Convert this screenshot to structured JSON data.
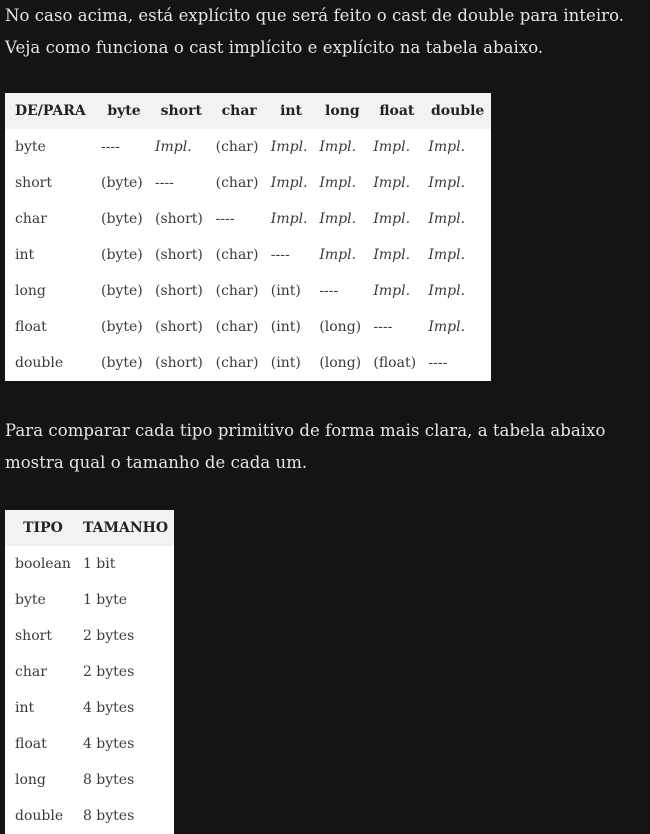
{
  "intro_paragraph": "No caso acima, está explícito que será feito o cast de double para inteiro. Veja como funciona o cast implícito e explícito na tabela abaixo.",
  "cast_table": {
    "headers": [
      "DE/PARA",
      "byte",
      "short",
      "char",
      "int",
      "long",
      "float",
      "double"
    ],
    "rows": [
      [
        "byte",
        "----",
        "Impl.",
        "(char)",
        "Impl.",
        "Impl.",
        "Impl.",
        "Impl."
      ],
      [
        "short",
        "(byte)",
        "----",
        "(char)",
        "Impl.",
        "Impl.",
        "Impl.",
        "Impl."
      ],
      [
        "char",
        "(byte)",
        "(short)",
        "----",
        "Impl.",
        "Impl.",
        "Impl.",
        "Impl."
      ],
      [
        "int",
        "(byte)",
        "(short)",
        "(char)",
        "----",
        "Impl.",
        "Impl.",
        "Impl."
      ],
      [
        "long",
        "(byte)",
        "(short)",
        "(char)",
        "(int)",
        "----",
        "Impl.",
        "Impl."
      ],
      [
        "float",
        "(byte)",
        "(short)",
        "(char)",
        "(int)",
        "(long)",
        "----",
        "Impl."
      ],
      [
        "double",
        "(byte)",
        "(short)",
        "(char)",
        "(int)",
        "(long)",
        "(float)",
        "----"
      ]
    ]
  },
  "second_paragraph": "Para comparar cada tipo primitivo de forma mais clara, a tabela abaixo mostra qual o tamanho de cada um.",
  "size_table": {
    "headers": [
      "TIPO",
      "TAMANHO"
    ],
    "rows": [
      [
        "boolean",
        "1 bit"
      ],
      [
        "byte",
        "1 byte"
      ],
      [
        "short",
        "2 bytes"
      ],
      [
        "char",
        "2 bytes"
      ],
      [
        "int",
        "4 bytes"
      ],
      [
        "float",
        "4 bytes"
      ],
      [
        "long",
        "8 bytes"
      ],
      [
        "double",
        "8 bytes"
      ]
    ]
  }
}
